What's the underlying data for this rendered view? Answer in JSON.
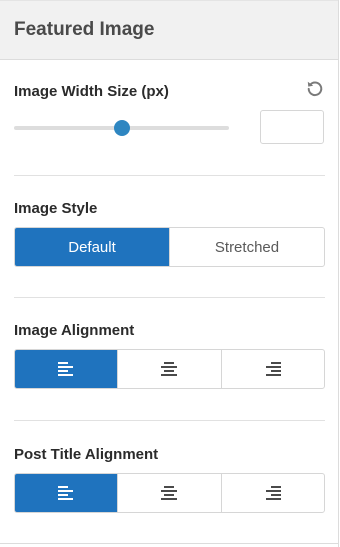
{
  "header": {
    "title": "Featured Image"
  },
  "width_size": {
    "label": "Image Width Size (px)",
    "reset_icon": "reset-icon",
    "slider_value": 0.5,
    "input_value": ""
  },
  "image_style": {
    "label": "Image Style",
    "options": [
      {
        "label": "Default",
        "active": true
      },
      {
        "label": "Stretched",
        "active": false
      }
    ]
  },
  "image_alignment": {
    "label": "Image Alignment",
    "options": [
      {
        "icon": "align-left-icon",
        "active": true
      },
      {
        "icon": "align-center-icon",
        "active": false
      },
      {
        "icon": "align-right-icon",
        "active": false
      }
    ]
  },
  "post_title_alignment": {
    "label": "Post Title Alignment",
    "options": [
      {
        "icon": "align-left-icon",
        "active": true
      },
      {
        "icon": "align-center-icon",
        "active": false
      },
      {
        "icon": "align-right-icon",
        "active": false
      }
    ]
  },
  "colors": {
    "accent": "#1f73be",
    "slider_thumb": "#2e86c1",
    "header_bg": "#f1f1f1"
  }
}
